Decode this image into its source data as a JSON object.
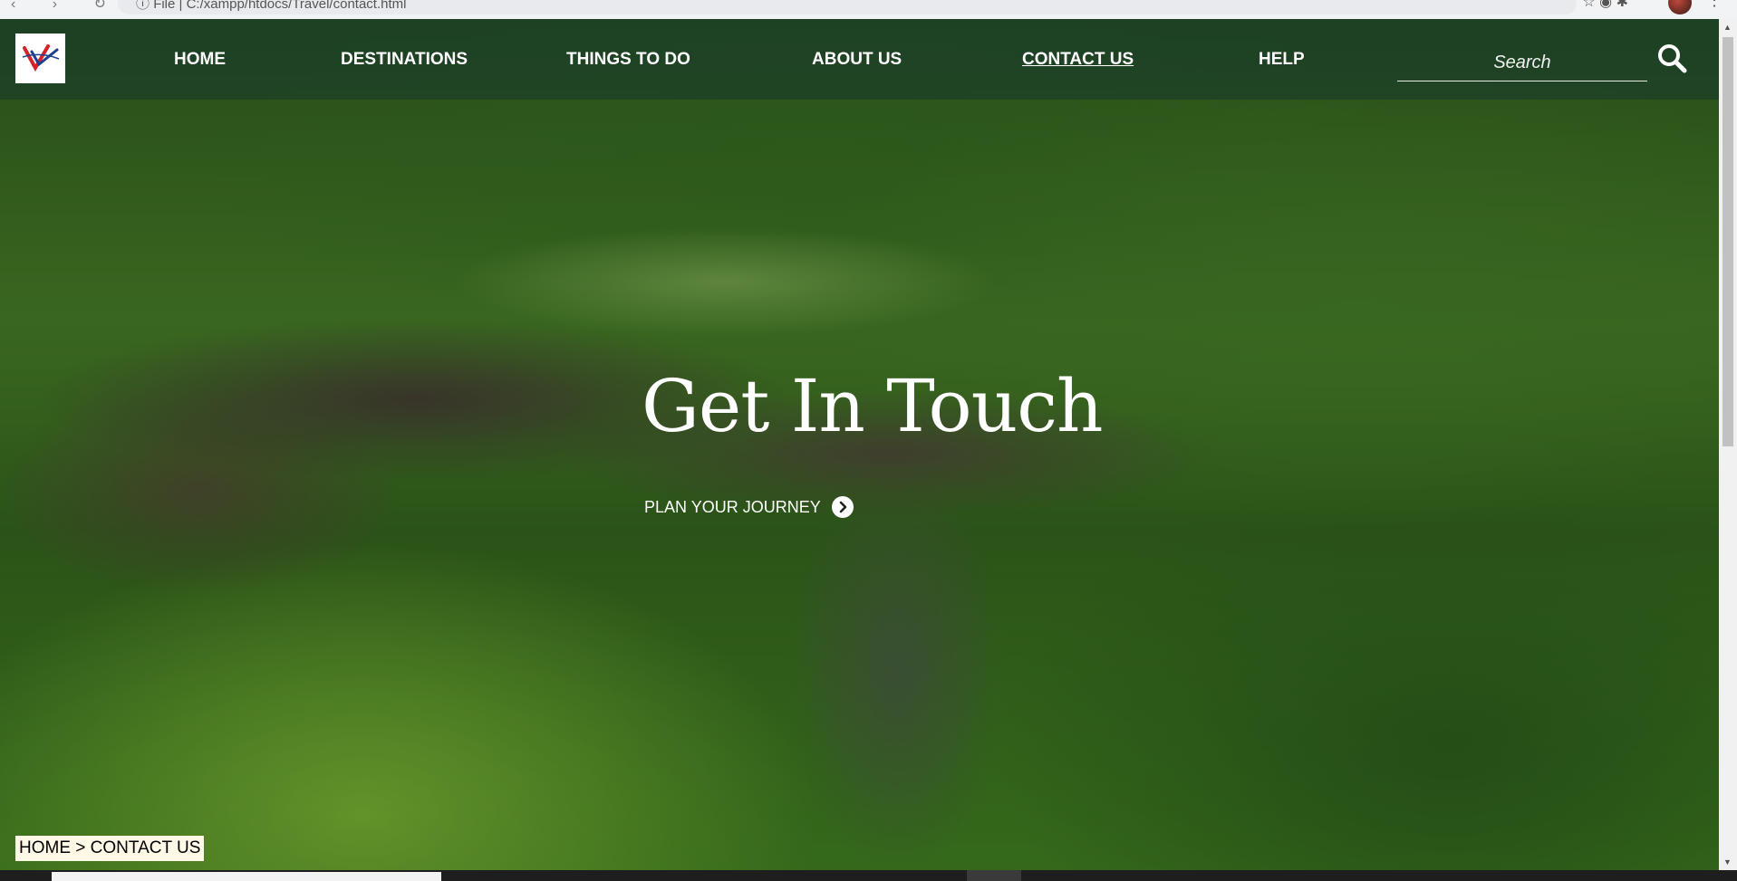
{
  "browser": {
    "url": "C:/xampp/htdocs/Travel/contact.html",
    "file_label": "File"
  },
  "nav": {
    "items": [
      {
        "label": "HOME"
      },
      {
        "label": "DESTINATIONS"
      },
      {
        "label": "THINGS TO DO"
      },
      {
        "label": "ABOUT US"
      },
      {
        "label": "CONTACT US",
        "active": true
      },
      {
        "label": "HELP"
      }
    ],
    "search_placeholder": "Search",
    "search_icon": "search-icon"
  },
  "hero": {
    "title": "Get In Touch",
    "cta_label": "PLAN YOUR JOURNEY",
    "cta_icon": "chevron-right-circle-icon"
  },
  "breadcrumb": "HOME > CONTACT US",
  "colors": {
    "navbar_overlay": "#16372d",
    "text": "#ffffff",
    "breadcrumb_bg": "#fff8e6",
    "logo_red": "#d6232a",
    "logo_blue": "#1f3f8f"
  }
}
